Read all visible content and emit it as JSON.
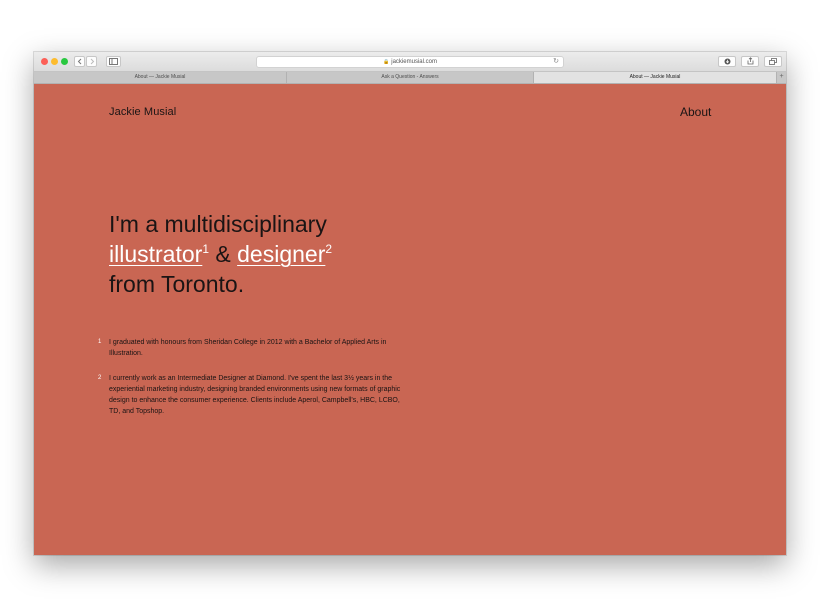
{
  "browser": {
    "url": "jackiemusial.com",
    "tabs": [
      {
        "label": "About — Jackie Musial"
      },
      {
        "label": "Ask a Question - Answers"
      },
      {
        "label": "About — Jackie Musial"
      }
    ],
    "new_tab_label": "+"
  },
  "site": {
    "name": "Jackie Musial",
    "nav": {
      "about": "About"
    }
  },
  "headline": {
    "line1": "I'm a multidisciplinary",
    "link1": "illustrator",
    "sup1": "1",
    "amp": " & ",
    "link2": "designer",
    "sup2": "2",
    "line3": "from Toronto."
  },
  "notes": [
    {
      "num": "1",
      "text": "I graduated with honours from Sheridan College in 2012 with a Bachelor of Applied Arts in Illustration."
    },
    {
      "num": "2",
      "text": "I currently work as an Intermediate Designer at Diamond. I've spent the last 3½ years in the experiential marketing industry, designing branded environments using new formats of graphic design to enhance the consumer experience. Clients include Aperol, Campbell's, HBC, LCBO, TD, and Topshop."
    }
  ],
  "colors": {
    "background": "#c96653",
    "text": "#1a1414",
    "link": "#ffffff"
  }
}
